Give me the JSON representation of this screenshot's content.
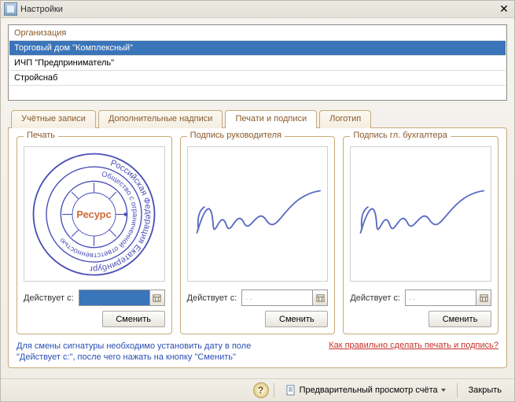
{
  "window": {
    "title": "Настройки"
  },
  "org": {
    "header": "Организация",
    "rows": [
      "Торговый дом \"Комплексный\"",
      "ИЧП \"Предприниматель\"",
      "Стройснаб"
    ],
    "selected_index": 0
  },
  "tabs": {
    "items": [
      "Учётные записи",
      "Дополнительные надписи",
      "Печати и подписи",
      "Логотип"
    ],
    "active_index": 2
  },
  "stamps": {
    "seal": {
      "legend": "Печать",
      "date_label": "Действует с:",
      "date_value": "",
      "change_btn": "Сменить",
      "ring_outer": "Российская Федерация Екатеринбург",
      "ring_mid": "Общество с ограниченной ответственностью",
      "center": "Ресурс"
    },
    "sig1": {
      "legend": "Подпись руководителя",
      "date_label": "Действует с:",
      "date_value": ".  .",
      "change_btn": "Сменить"
    },
    "sig2": {
      "legend": "Подпись гл. бухгалтера",
      "date_label": "Действует с:",
      "date_value": ".  .",
      "change_btn": "Сменить"
    }
  },
  "hints": {
    "left_line1": "Для смены сигнатуры необходимо установить дату в поле",
    "left_line2": "\"Действует с:\", после чего нажать на кнопку \"Сменить\"",
    "right": "Как правильно сделать печать и подпись?"
  },
  "status": {
    "preview": "Предварительный просмотр счёта",
    "close": "Закрыть"
  },
  "colors": {
    "stamp": "#4a4fb5",
    "ink": "#5a6cc1"
  }
}
